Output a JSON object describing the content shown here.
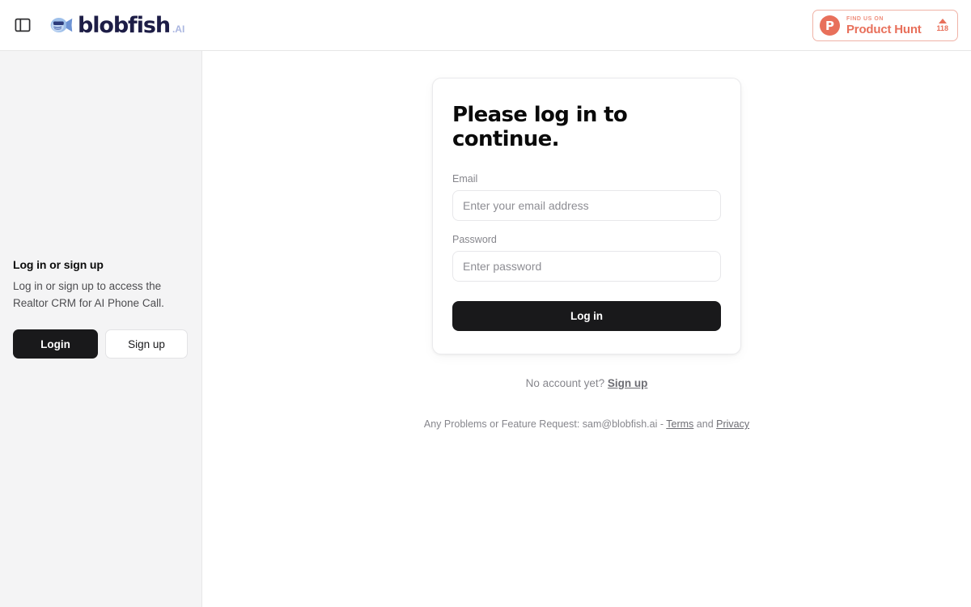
{
  "header": {
    "panel_toggle_icon": "sidebar-panel-icon",
    "brand": {
      "mark_icon": "blobfish-logo-icon",
      "name": "blobfish",
      "suffix": ".AI"
    },
    "product_hunt": {
      "logo_letter": "P",
      "kicker": "FIND US ON",
      "title": "Product Hunt",
      "upvote_icon": "caret-up-icon",
      "upvote_count": "118",
      "accent_color": "#e8705b",
      "border_color": "#f0b3a7"
    }
  },
  "sidebar": {
    "title": "Log in or sign up",
    "description": "Log in or sign up to access the Realtor CRM for AI Phone Call.",
    "login_label": "Login",
    "signup_label": "Sign up",
    "background_color": "#f4f4f5"
  },
  "main": {
    "card": {
      "title": "Please log in to continue.",
      "email": {
        "label": "Email",
        "placeholder": "Enter your email address",
        "value": ""
      },
      "password": {
        "label": "Password",
        "placeholder": "Enter password",
        "value": ""
      },
      "submit_label": "Log in",
      "submit_color": "#19191b"
    },
    "signup_prompt": {
      "text": "No account yet?",
      "link": "Sign up"
    },
    "footer": {
      "prefix": "Any Problems or Feature Request: sam@blobfish.ai -",
      "terms_link": "Terms",
      "conjunction": "and",
      "privacy_link": "Privacy"
    }
  }
}
